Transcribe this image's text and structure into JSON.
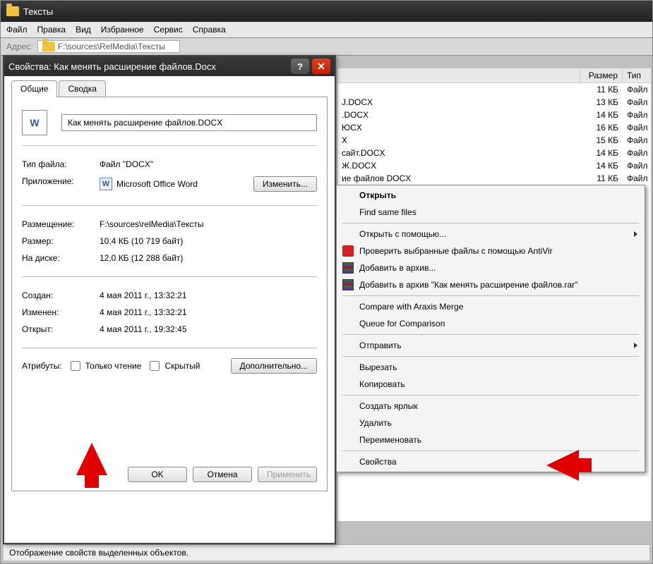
{
  "explorer": {
    "title": "Тексты",
    "menu": [
      "Файл",
      "Правка",
      "Вид",
      "Избранное",
      "Сервис",
      "Справка"
    ],
    "addr_label": "Адрес:",
    "addr_value": "F:\\sources\\RelMedia\\Тексты"
  },
  "file_list": {
    "columns": {
      "size": "Размер",
      "type": "Тип"
    },
    "rows": [
      {
        "name": "",
        "size": "11 КБ",
        "type": "Файл"
      },
      {
        "name": "J.DOCX",
        "size": "13 КБ",
        "type": "Файл"
      },
      {
        "name": ".DOCX",
        "size": "14 КБ",
        "type": "Файл"
      },
      {
        "name": "ЮCX",
        "size": "16 КБ",
        "type": "Файл"
      },
      {
        "name": "X",
        "size": "15 КБ",
        "type": "Файл"
      },
      {
        "name": "сайт.DOCX",
        "size": "14 КБ",
        "type": "Файл"
      },
      {
        "name": "Ж.DOCX",
        "size": "14 КБ",
        "type": "Файл"
      },
      {
        "name": "ие файлов DOCX",
        "size": "11 КБ",
        "type": "Файл"
      }
    ]
  },
  "dialog": {
    "title": "Свойства: Как менять расширение файлов.Docx",
    "tabs": {
      "general": "Общие",
      "summary": "Сводка"
    },
    "filename": "Как менять расширение файлов.DOCX",
    "rows": {
      "type_label": "Тип файла:",
      "type_value": "Файл \"DOCX\"",
      "app_label": "Приложение:",
      "app_value": "Microsoft Office Word",
      "change_btn": "Изменить...",
      "location_label": "Размещение:",
      "location_value": "F:\\sources\\relMedia\\Тексты",
      "size_label": "Размер:",
      "size_value": "10,4 КБ (10 719 байт)",
      "ondisk_label": "На диске:",
      "ondisk_value": "12,0 КБ (12 288 байт)",
      "created_label": "Создан:",
      "created_value": "4 мая 2011 г., 13:32:21",
      "modified_label": "Изменен:",
      "modified_value": "4 мая 2011 г., 13:32:21",
      "accessed_label": "Открыт:",
      "accessed_value": "4 мая 2011 г., 19:32:45",
      "attrs_label": "Атрибуты:",
      "readonly": "Только чтение",
      "hidden": "Скрытый",
      "advanced": "Дополнительно..."
    },
    "buttons": {
      "ok": "OK",
      "cancel": "Отмена",
      "apply": "Применить"
    }
  },
  "context_menu": {
    "open": "Открыть",
    "find_same": "Find same files",
    "open_with": "Открыть с помощью...",
    "antivir": "Проверить выбранные файлы с помощью AntiVir",
    "archive_add": "Добавить в архив...",
    "archive_named": "Добавить в архив \"Как менять расширение файлов.rar\"",
    "compare": "Compare with Araxis Merge",
    "queue": "Queue for Comparison",
    "send": "Отправить",
    "cut": "Вырезать",
    "copy": "Копировать",
    "shortcut": "Создать ярлык",
    "delete": "Удалить",
    "rename": "Переименовать",
    "properties": "Свойства"
  },
  "status_bar": "Отображение свойств выделенных объектов."
}
